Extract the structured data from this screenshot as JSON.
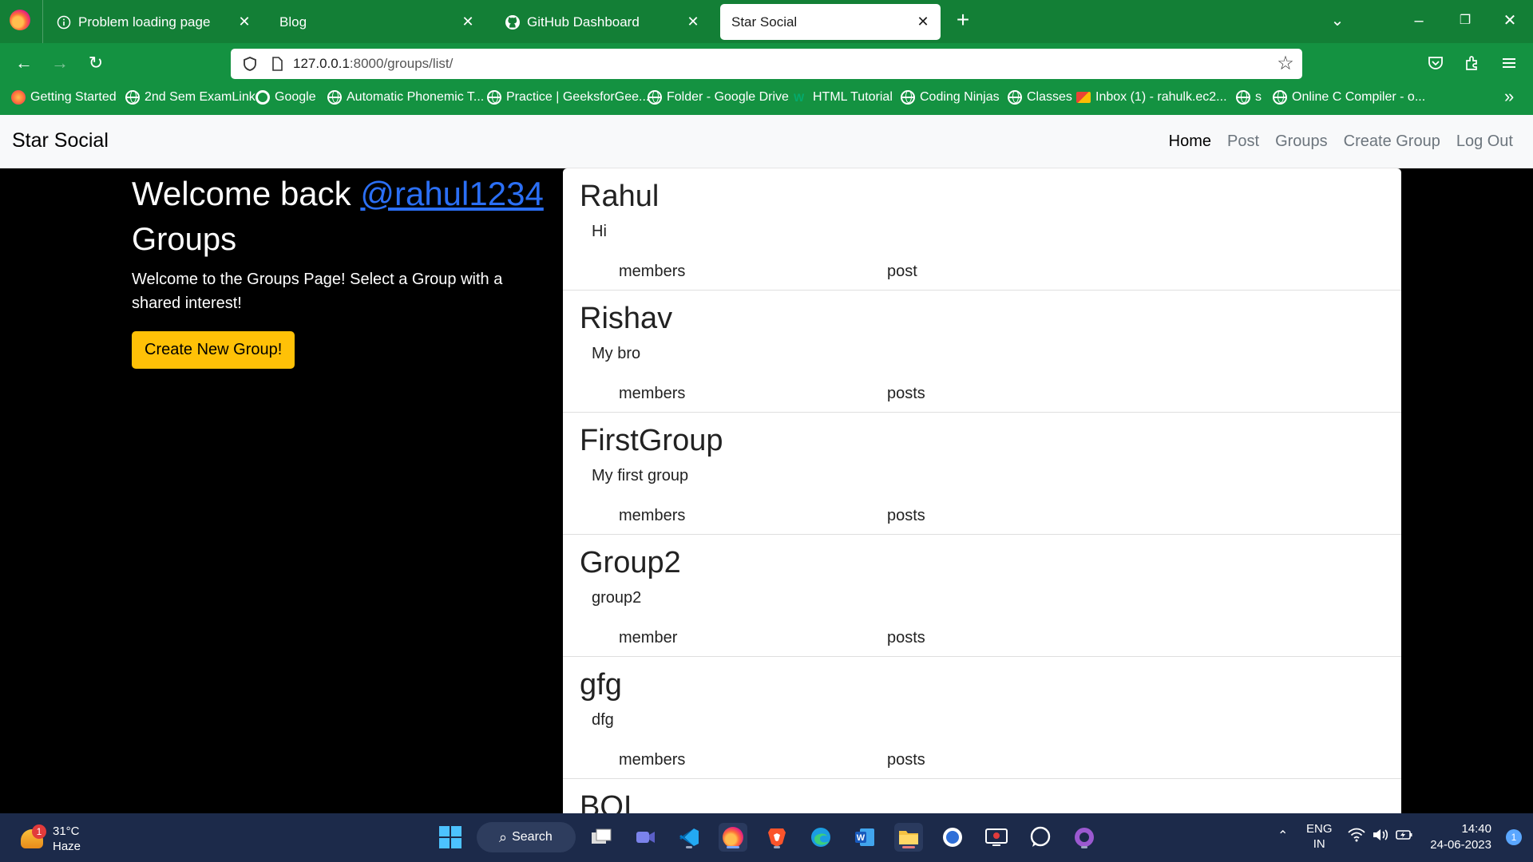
{
  "browser": {
    "tabs": [
      {
        "title": "Problem loading page",
        "icon": "info-icon"
      },
      {
        "title": "Blog",
        "icon": ""
      },
      {
        "title": "GitHub Dashboard",
        "icon": "github-icon"
      },
      {
        "title": "Star Social",
        "icon": ""
      }
    ],
    "url_host": "127.0.0.1",
    "url_path": ":8000/groups/list/",
    "bookmarks": [
      "Getting Started",
      "2nd Sem ExamLink",
      "Google",
      "Automatic Phonemic T...",
      "Practice | GeeksforGee...",
      "Folder - Google Drive",
      "HTML Tutorial",
      "Coding Ninjas",
      "Classes",
      "Inbox (1) - rahulk.ec2...",
      "s",
      "Online C Compiler - o..."
    ],
    "accent_color": "#149241"
  },
  "site": {
    "brand": "Star Social",
    "nav": [
      "Home",
      "Post",
      "Groups",
      "Create Group",
      "Log Out"
    ],
    "welcome_prefix": "Welcome back ",
    "username": "@rahul1234",
    "groups_heading": "Groups",
    "lead": "Welcome to the Groups Page! Select a Group with a shared interest!",
    "create_button": "Create New Group!",
    "groups": [
      {
        "name": "Rahul",
        "description": "Hi",
        "members": "members",
        "posts": "post"
      },
      {
        "name": "Rishav",
        "description": "My bro",
        "members": "members",
        "posts": "posts"
      },
      {
        "name": "FirstGroup",
        "description": "My first group",
        "members": "members",
        "posts": "posts"
      },
      {
        "name": "Group2",
        "description": "group2",
        "members": "member",
        "posts": "posts"
      },
      {
        "name": "gfg",
        "description": "dfg",
        "members": "members",
        "posts": "posts"
      },
      {
        "name": "BOI",
        "description": "",
        "members": "",
        "posts": ""
      }
    ]
  },
  "taskbar": {
    "weather_temp": "31°C",
    "weather_condition": "Haze",
    "weather_badge": "1",
    "search_label": "Search",
    "language": "ENG",
    "region": "IN",
    "time": "14:40",
    "date": "24-06-2023",
    "notifications": "1"
  }
}
